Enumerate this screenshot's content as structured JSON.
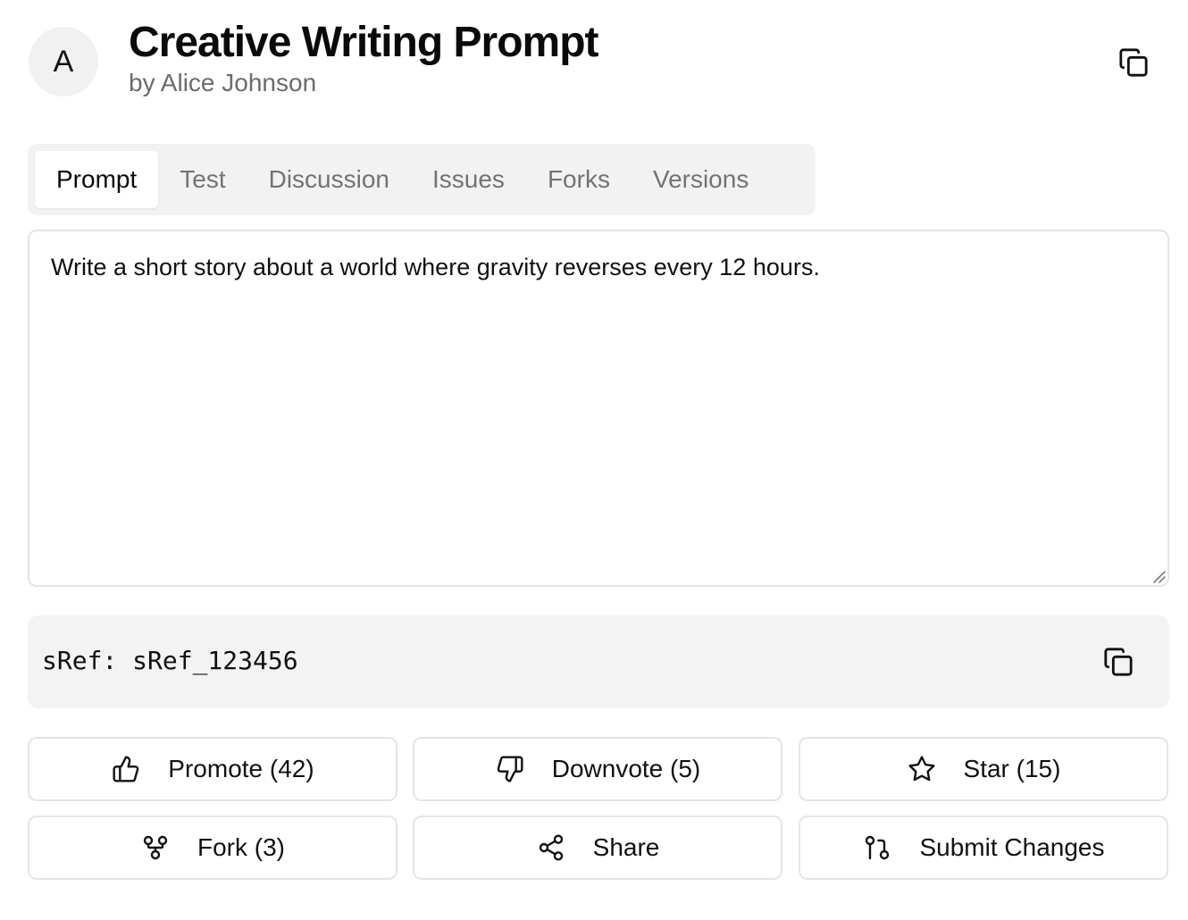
{
  "header": {
    "avatar_initial": "A",
    "title": "Creative Writing Prompt",
    "author": "by Alice Johnson",
    "copy_icon": "copy-icon"
  },
  "tabs": [
    {
      "label": "Prompt",
      "active": true
    },
    {
      "label": "Test",
      "active": false
    },
    {
      "label": "Discussion",
      "active": false
    },
    {
      "label": "Issues",
      "active": false
    },
    {
      "label": "Forks",
      "active": false
    },
    {
      "label": "Versions",
      "active": false
    }
  ],
  "prompt": {
    "text": "Write a short story about a world where gravity reverses every 12 hours."
  },
  "sref": {
    "text": "sRef: sRef_123456",
    "copy_icon": "copy-icon"
  },
  "actions": {
    "promote": {
      "label": "Promote (42)",
      "icon": "thumbs-up-icon"
    },
    "downvote": {
      "label": "Downvote (5)",
      "icon": "thumbs-down-icon"
    },
    "star": {
      "label": "Star (15)",
      "icon": "star-icon"
    },
    "fork": {
      "label": "Fork (3)",
      "icon": "git-fork-icon"
    },
    "share": {
      "label": "Share",
      "icon": "share-icon"
    },
    "submit": {
      "label": "Submit Changes",
      "icon": "git-pull-request-icon"
    }
  },
  "colors": {
    "tab_bar_bg": "#f2f2f2",
    "sref_bg": "#f3f3f3",
    "border": "#e5e5e5",
    "muted_text": "#737373"
  }
}
